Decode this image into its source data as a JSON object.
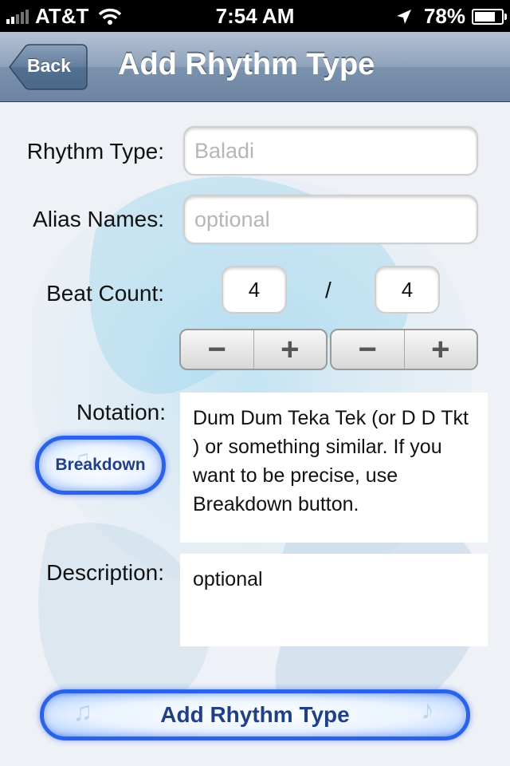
{
  "status_bar": {
    "carrier": "AT&T",
    "time": "7:54 AM",
    "battery_percent": "78%",
    "battery_level": 0.78,
    "icons": [
      "signal-bars-icon",
      "wifi-icon",
      "location-arrow-icon",
      "battery-icon"
    ]
  },
  "nav": {
    "back_label": "Back",
    "title": "Add Rhythm Type"
  },
  "form": {
    "rhythm_type": {
      "label": "Rhythm Type:",
      "value": "",
      "placeholder": "Baladi"
    },
    "alias_names": {
      "label": "Alias Names:",
      "value": "",
      "placeholder": "optional"
    },
    "beat_count": {
      "label": "Beat Count:",
      "numerator": "4",
      "separator": "/",
      "denominator": "4",
      "minus": "−",
      "plus": "+"
    },
    "notation": {
      "label": "Notation:",
      "breakdown_label": "Breakdown",
      "text": "Dum Dum Teka Tek (or D D Tkt ) or something similar. If you want to be precise, use Breakdown button."
    },
    "description": {
      "label": "Description:",
      "text": "optional"
    },
    "submit_label": "Add Rhythm Type"
  },
  "colors": {
    "nav_gradient_top": "#b5c3d4",
    "nav_gradient_bottom": "#6c84a2",
    "glow_button_border": "#2a63e8",
    "glow_button_text": "#1f3f86",
    "background": "#eef1f6"
  }
}
